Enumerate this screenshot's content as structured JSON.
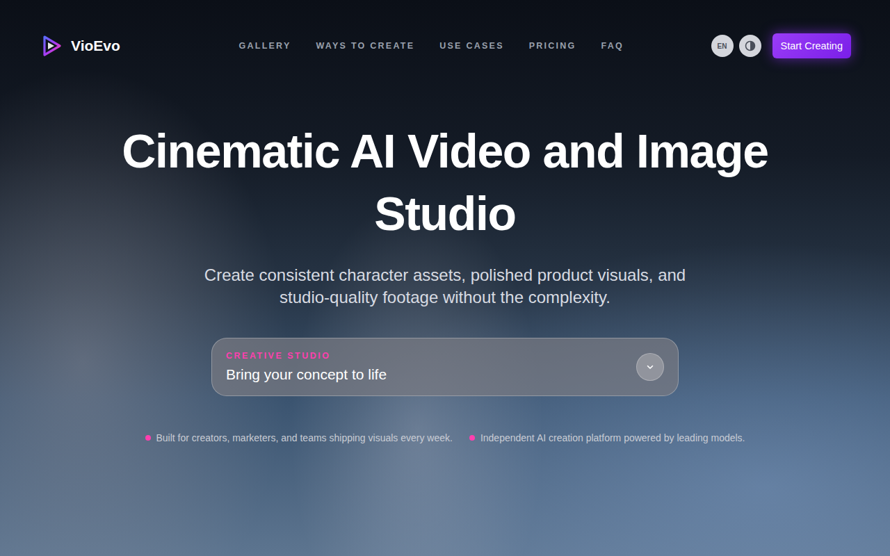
{
  "brand": {
    "name": "VioEvo"
  },
  "nav": [
    {
      "label": "GALLERY"
    },
    {
      "label": "WAYS TO CREATE"
    },
    {
      "label": "USE CASES"
    },
    {
      "label": "PRICING"
    },
    {
      "label": "FAQ"
    }
  ],
  "header_actions": {
    "language": "EN",
    "cta": "Start Creating"
  },
  "hero": {
    "title": "Cinematic AI Video and Image Studio",
    "subtitle": "Create consistent character assets, polished product visuals, and studio-quality footage without the complexity.",
    "studio_select": {
      "label": "CREATIVE STUDIO",
      "value": "Bring your concept to life",
      "expanded": false
    },
    "highlights": [
      {
        "text": "Built for creators, marketers, and teams shipping visuals every week."
      },
      {
        "text": "Independent AI creation platform powered by leading models."
      }
    ]
  }
}
